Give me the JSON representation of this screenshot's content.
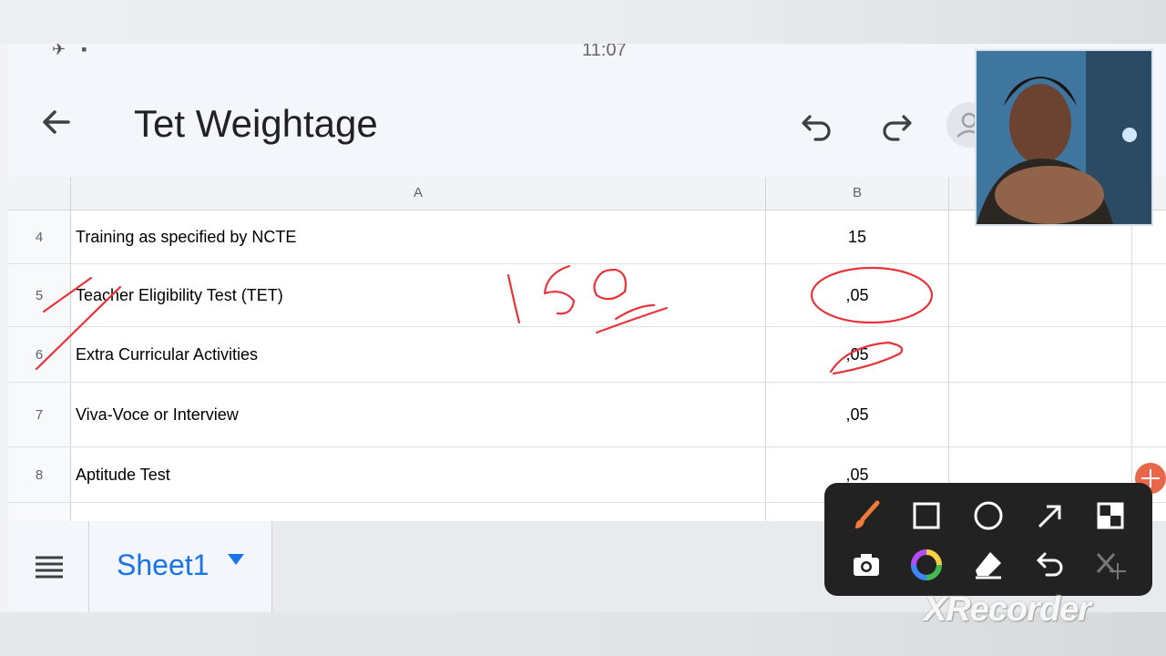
{
  "status_bar": {
    "left_icons": "✈ ▪",
    "time": "11:07"
  },
  "header": {
    "title": "Tet Weightage",
    "icons": {
      "back": "arrow-left-icon",
      "undo": "undo-icon",
      "redo": "redo-icon",
      "share": "person-icon"
    }
  },
  "sheet": {
    "columns": [
      "A",
      "B"
    ],
    "rows": [
      {
        "num": "4",
        "a": "Training as specified by NCTE",
        "b": "15"
      },
      {
        "num": "5",
        "a": "Teacher Eligibility Test (TET)",
        "b": ",05"
      },
      {
        "num": "6",
        "a": "Extra Curricular Activities",
        "b": ",05"
      },
      {
        "num": "7",
        "a": "Viva-Voce or Interview",
        "b": ",05"
      },
      {
        "num": "8",
        "a": "Aptitude Test",
        "b": ",05"
      }
    ]
  },
  "bottom_bar": {
    "sheet_tab": "Sheet1",
    "menu_icon": "menu-icon"
  },
  "recorder": {
    "tools": [
      "brush-icon",
      "rectangle-icon",
      "circle-icon",
      "arrow-icon",
      "shape-icon",
      "camera-icon",
      "color-wheel-icon",
      "eraser-icon",
      "undo-icon",
      "close-icon"
    ],
    "watermark": "XRecorder",
    "colors": {
      "brush": "#f07a3a",
      "ink": "#e8333a",
      "toolbar": "#222222"
    }
  },
  "annotation": {
    "handwritten_text": "150"
  }
}
